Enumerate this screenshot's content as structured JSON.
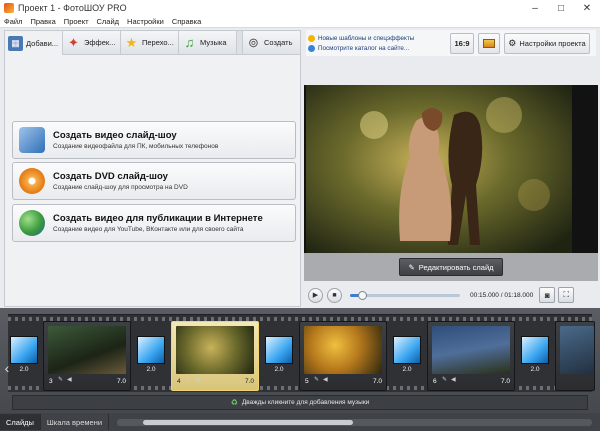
{
  "window": {
    "title": "Проект 1 - ФотоШОУ PRO",
    "controls": [
      "–",
      "□",
      "✕"
    ]
  },
  "menu": [
    "Файл",
    "Правка",
    "Проект",
    "Слайд",
    "Настройки",
    "Справка"
  ],
  "tabs": [
    {
      "label": "Добави...",
      "icon": "add-photos-icon",
      "active": true
    },
    {
      "label": "Эффек...",
      "icon": "effects-icon",
      "active": false
    },
    {
      "label": "Перехо...",
      "icon": "transitions-star-icon",
      "active": false
    },
    {
      "label": "Музыка",
      "icon": "music-note-icon",
      "active": false
    },
    {
      "label": "Создать",
      "icon": "film-reel-icon",
      "active": false
    }
  ],
  "export_options": [
    {
      "title": "Создать видео слайд-шоу",
      "subtitle": "Создание видеофайла для ПК, мобильных телефонов",
      "icon": "video-file-icon",
      "color": "#2f6fb8"
    },
    {
      "title": "Создать DVD слайд-шоу",
      "subtitle": "Создание слайд-шоу для просмотра на DVD",
      "icon": "dvd-disc-icon",
      "color": "#e8831c"
    },
    {
      "title": "Создать видео для публикации в Интернете",
      "subtitle": "Создание видео для YouTube, ВКонтакте или для своего сайта",
      "icon": "globe-icon",
      "color": "#3c9a3c"
    }
  ],
  "links": {
    "new_templates": "Новые шаблоны и спецэффекты",
    "catalog": "Посмотрите каталог на сайте..."
  },
  "toolbar": {
    "aspect": "16:9",
    "settings": "Настройки проекта"
  },
  "preview": {
    "edit_button": "Редактировать слайд"
  },
  "player": {
    "time": "00:15.000 / 01:18.000",
    "progress": 0.11
  },
  "slides": [
    {
      "num": "3",
      "duration": "7.0",
      "selected": false
    },
    {
      "num": "4",
      "duration": "7.0",
      "selected": true
    },
    {
      "num": "5",
      "duration": "7.0",
      "selected": false
    },
    {
      "num": "6",
      "duration": "7.0",
      "selected": false
    }
  ],
  "transitions": [
    "2.0",
    "2.0",
    "2.0",
    "2.0",
    "2.0",
    "2.0"
  ],
  "music_hint": "Дважды кликните для добавления музыки",
  "bottom_tabs": [
    "Слайды",
    "Шкала времени"
  ]
}
